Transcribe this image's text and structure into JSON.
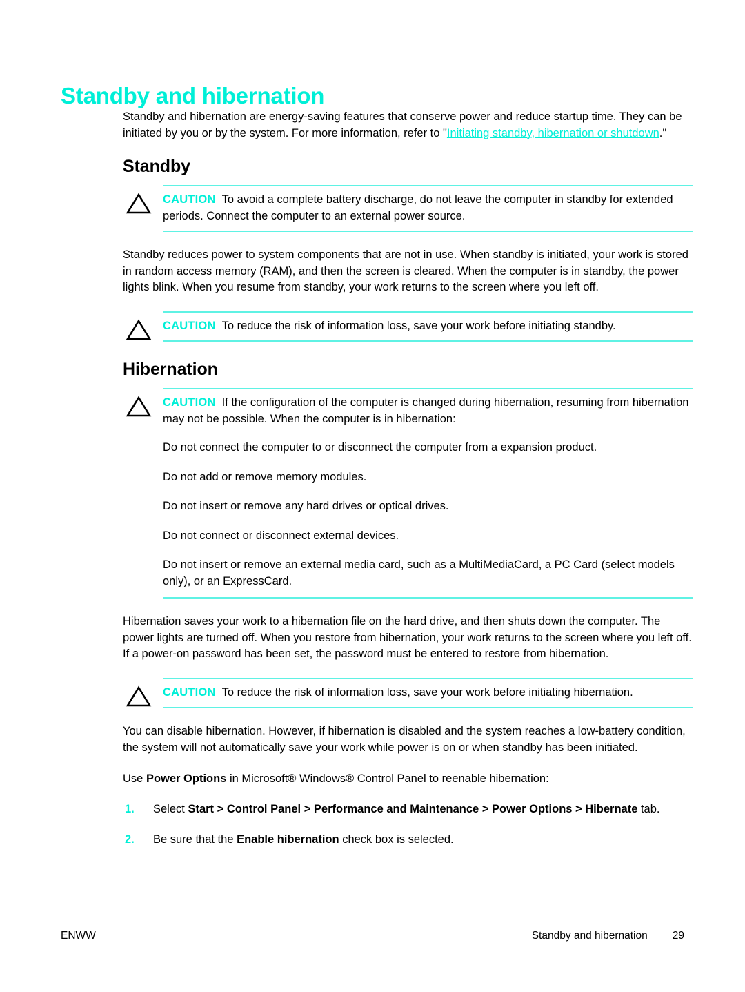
{
  "document": {
    "title": "Standby and hibernation",
    "title_color": "#00efd7",
    "accent_color": "#00efd7",
    "rule_color": "#5ff2e4"
  },
  "intro": {
    "text_before_link": "Standby and hibernation are energy-saving features that conserve power and reduce startup time. They can be initiated by you or by the system. For more information, refer to \"",
    "link_text": "Initiating standby, hibernation or shutdown",
    "text_after_link": ".\""
  },
  "sections": [
    {
      "heading": "Standby",
      "notes": [
        {
          "label": "CAUTION",
          "icon": "warning-triangle-icon",
          "text": "To avoid a complete battery discharge, do not leave the computer in standby for extended periods. Connect the computer to an external power source.",
          "sublist": []
        }
      ],
      "paragraphs": [
        "Standby reduces power to system components that are not in use. When standby is initiated, your work is stored in random access memory (RAM), and then the screen is cleared. When the computer is in standby, the power lights blink. When you resume from standby, your work returns to the screen where you left off."
      ],
      "notes_after": [
        {
          "label": "CAUTION",
          "icon": "warning-triangle-icon",
          "text": "To reduce the risk of information loss, save your work before initiating standby.",
          "sublist": []
        }
      ]
    },
    {
      "heading": "Hibernation",
      "notes": [
        {
          "label": "CAUTION",
          "icon": "warning-triangle-icon",
          "text": "If the configuration of the computer is changed during hibernation, resuming from hibernation may not be possible. When the computer is in hibernation:",
          "sublist": [
            "Do not connect the computer to or disconnect the computer from a expansion product.",
            "Do not add or remove memory modules.",
            "Do not insert or remove any hard drives or optical drives.",
            "Do not connect or disconnect external devices.",
            "Do not insert or remove an external media card, such as a MultiMediaCard, a PC Card (select models only), or an ExpressCard."
          ]
        }
      ],
      "paragraphs": [
        "Hibernation saves your work to a hibernation file on the hard drive, and then shuts down the computer. The power lights are turned off. When you restore from hibernation, your work returns to the screen where you left off. If a power-on password has been set, the password must be entered to restore from hibernation."
      ],
      "notes_after": [
        {
          "label": "CAUTION",
          "icon": "warning-triangle-icon",
          "text": "To reduce the risk of information loss, save your work before initiating hibernation.",
          "sublist": []
        }
      ],
      "paragraphs_after": [
        "You can disable hibernation. However, if hibernation is disabled and the system reaches a low-battery condition, the system will not automatically save your work while power is on or when standby has been initiated."
      ]
    }
  ],
  "power_options": {
    "lead_before_bold": "Use ",
    "lead_bold": "Power Options",
    "lead_after_bold": " in Microsoft® Windows® Control Panel to reenable hibernation:",
    "steps": [
      {
        "number": "1.",
        "plain_before": "Select ",
        "bold": "Start > Control Panel > Performance and Maintenance > Power Options > Hibernate",
        "plain_after": " tab."
      },
      {
        "number": "2.",
        "plain_before": "Be sure that the ",
        "bold": "Enable hibernation",
        "plain_after": " check box is selected."
      }
    ]
  },
  "footer": {
    "left": "ENWW",
    "chapter": "Standby and hibernation",
    "page_number": "29"
  }
}
